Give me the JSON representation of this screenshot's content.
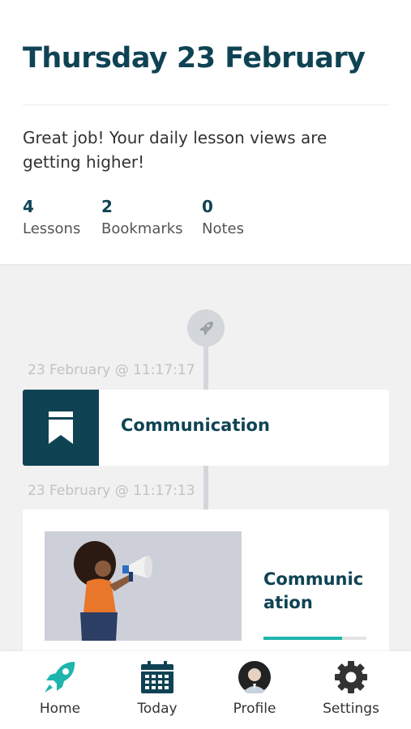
{
  "header": {
    "date_title": "Thursday 23 February",
    "message": "Great job! Your daily lesson views are getting higher!",
    "stats": [
      {
        "value": "4",
        "label": "Lessons"
      },
      {
        "value": "2",
        "label": "Bookmarks"
      },
      {
        "value": "0",
        "label": "Notes"
      }
    ]
  },
  "timeline": {
    "start_icon": "rocket-icon",
    "entries": [
      {
        "timestamp": "23 February @ 11:17:17",
        "type": "bookmark",
        "icon": "bookmark-icon",
        "title": "Communication"
      },
      {
        "timestamp": "23 February @ 11:17:13",
        "type": "lesson",
        "image": "woman-with-megaphone",
        "title": "Communication",
        "progress": 0.76
      }
    ]
  },
  "colors": {
    "primary": "#0f4354",
    "accent": "#1fb5ad",
    "background": "#f1f1f1",
    "timeline": "#d3d6da"
  },
  "nav": {
    "items": [
      {
        "label": "Home",
        "icon": "rocket-icon",
        "active": true
      },
      {
        "label": "Today",
        "icon": "calendar-icon",
        "active": false
      },
      {
        "label": "Profile",
        "icon": "avatar-icon",
        "active": false
      },
      {
        "label": "Settings",
        "icon": "gear-icon",
        "active": false
      }
    ]
  }
}
